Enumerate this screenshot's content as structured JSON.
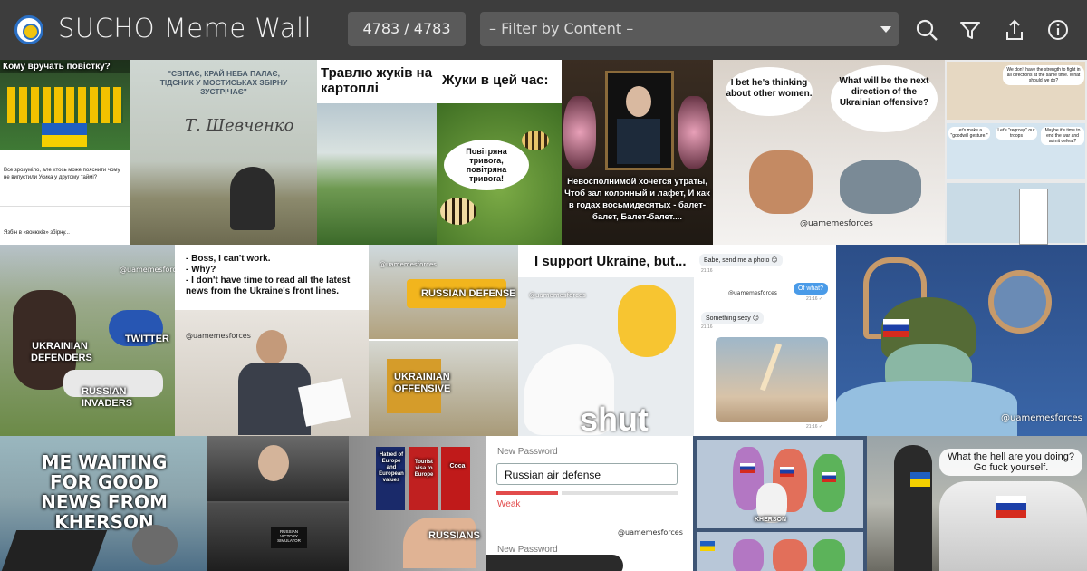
{
  "header": {
    "title": "SUCHO Meme Wall",
    "counter": "4783 / 4783",
    "filter_placeholder": "– Filter by Content –"
  },
  "toolbar": {
    "search_icon": "search-icon",
    "filter_icon": "filter-icon",
    "upload_icon": "upload-icon",
    "info_icon": "info-icon"
  },
  "memes": {
    "m1": {
      "top": "Кому вручать повістку?",
      "post1": "Все зрозуміло, але хтось може пояснити чому не випустили Усика у другому таймі?",
      "post2": "Язбін в «вонюків» збірну..."
    },
    "m2": {
      "quote": "\"СВІТАЄ, КРАЙ НЕБА ПАЛАЄ, ТІДСНИК У МОСТИСЬКАХ ЗБІРНУ ЗУСТРІЧАЄ\"",
      "sig": "Т. Шевченко"
    },
    "m3": {
      "left": "Травлю жуків на картоплі",
      "right": "Жуки в цей час:",
      "bubble": "Повітряна тривога, повітряна тривога!"
    },
    "m4": {
      "poem": "Невосполнимой хочется утраты, Чтоб зал колонный и лафет, И как в годах восьмидесятых - балет-балет, Балет-балет...."
    },
    "m5": {
      "left": "I bet he's thinking about other women.",
      "right": "What will be the next direction of the Ukrainian offensive?",
      "handle": "@uamemesforces"
    },
    "m6": {
      "top": "We don't have the strength to fight in all directions at the same time. What should we do?",
      "a": "Let's make a \"goodwill gesture.\"",
      "b": "Let's \"regroup\" our troops",
      "c": "Maybe it's time to end the war and admit defeat?"
    },
    "m7": {
      "a": "UKRAINIAN DEFENDERS",
      "b": "TWITTER",
      "c": "RUSSIAN INVADERS",
      "handle": "@uamemesforces"
    },
    "m8": {
      "text": "- Boss, I can't work.\n- Why?\n- I don't have time to read all the latest news from the Ukraine's front lines.",
      "handle": "@uamemesforces"
    },
    "m9": {
      "a": "RUSSIAN DEFENSE",
      "b": "UKRAINIAN OFFENSIVE",
      "handle": "@uamemesforces"
    },
    "m10": {
      "top": "I support Ukraine, but...",
      "bottom": "shut",
      "handle": "@uamemesforces"
    },
    "m11": {
      "msg1": "Babe, send me a photo 😏",
      "time1": "21:16",
      "msg2": "Of what?",
      "time2": "21:16 ✓",
      "msg3": "Something sexy 😏",
      "time3": "21:16",
      "time4": "21:16 ✓",
      "handle": "@uamemesforces"
    },
    "m12": {
      "handle": "@uamemesforces"
    },
    "m13": {
      "text": "ME WAITING FOR GOOD NEWS FROM KHERSON"
    },
    "m14": {
      "sign": "RUSSIAN VICTORY SIMULATOR"
    },
    "m15": {
      "a": "Hatred of Europe and European values",
      "b": "Tourist visa to Europe",
      "c": "Coca",
      "d": "RUSSIANS"
    },
    "m16": {
      "label": "New Password",
      "value": "Russian air defense",
      "strength": "Weak",
      "label2": "New Password",
      "handle": "@uamemesforces"
    },
    "m17": {
      "label": "KHERSON"
    },
    "m18": {
      "text": "What the hell are you doing? Go fuck yourself."
    }
  },
  "colors": {
    "topbar": "#3d3d3d",
    "field": "#5a5a5a",
    "accent": "#e24b4b"
  }
}
